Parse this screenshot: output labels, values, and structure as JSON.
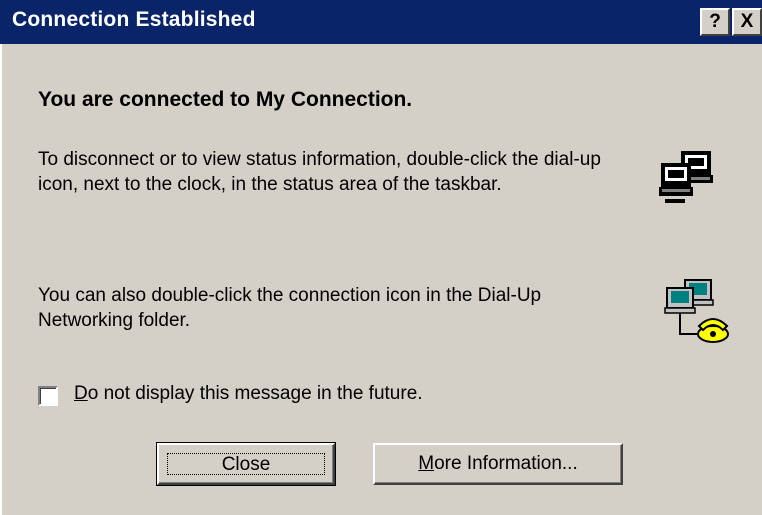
{
  "window": {
    "title": "Connection Established",
    "help_glyph": "?",
    "close_glyph": "X"
  },
  "message": {
    "heading": "You are connected to My Connection.",
    "paragraph1": "To disconnect or to view status information, double-click the dial-up icon, next to the clock, in the status area of the taskbar.",
    "paragraph2": "You can also double-click the connection icon in the Dial-Up Networking folder."
  },
  "icons": {
    "status_icon": "dialup-tray-computers-icon",
    "folder_icon": "dial-up-networking-icon"
  },
  "checkbox": {
    "label_first": "D",
    "label_rest": "o not display this message in the future.",
    "checked": false
  },
  "buttons": {
    "close_label": "Close",
    "more_first": "M",
    "more_rest": "ore Information..."
  },
  "colors": {
    "titlebar": "#0a246a",
    "face": "#d4d0c8"
  }
}
